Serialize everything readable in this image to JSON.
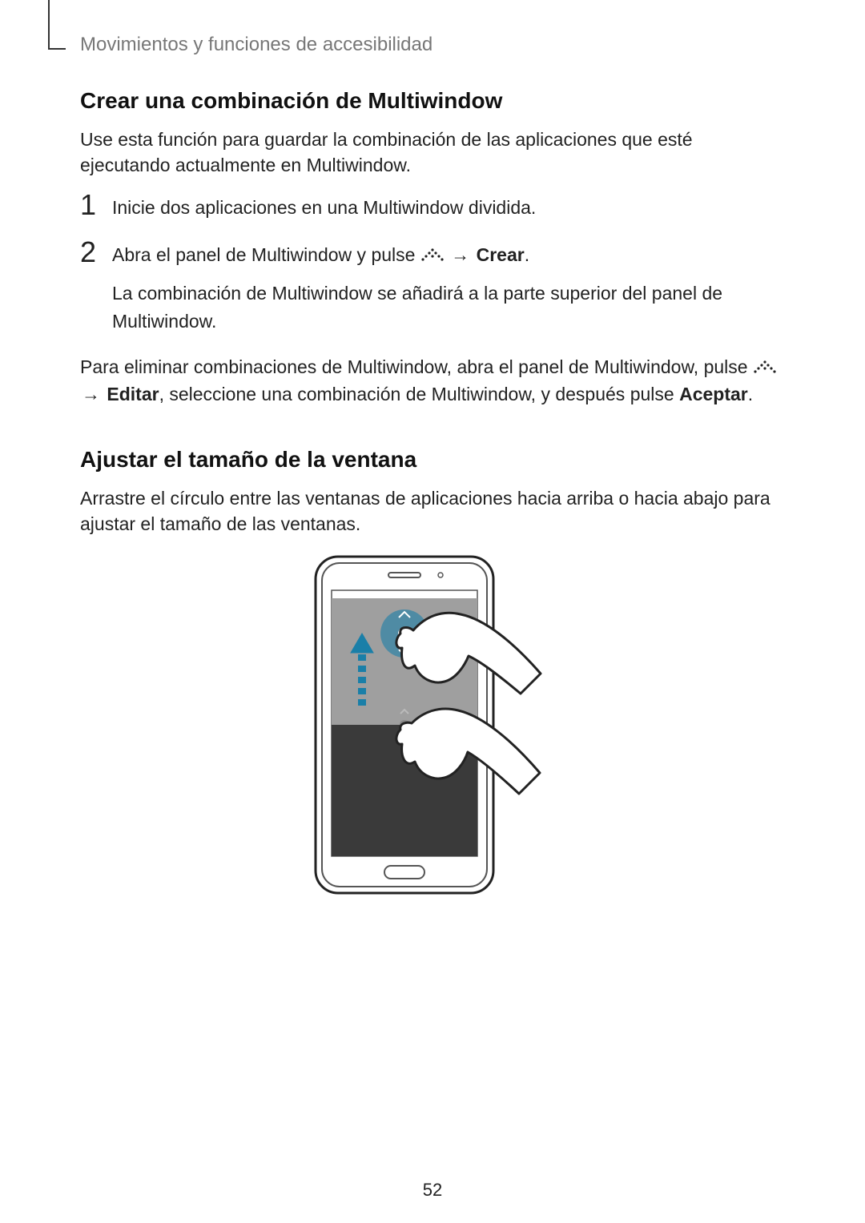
{
  "breadcrumb": "Movimientos y funciones de accesibilidad",
  "section1": {
    "title": "Crear una combinación de Multiwindow",
    "intro": "Use esta función para guardar la combinación de las aplicaciones que esté ejecutando actualmente en Multiwindow.",
    "step1_num": "1",
    "step1_text": "Inicie dos aplicaciones en una Multiwindow dividida.",
    "step2_num": "2",
    "step2_text_a": "Abra el panel de Multiwindow y pulse ",
    "step2_arrow": "→",
    "step2_crear": "Crear",
    "step2_period": ".",
    "step2_sub": "La combinación de Multiwindow se añadirá a la parte superior del panel de Multiwindow.",
    "after_a": "Para eliminar combinaciones de Multiwindow, abra el panel de Multiwindow, pulse ",
    "after_arrow": "→",
    "after_editar": "Editar",
    "after_b": ", seleccione una combinación de Multiwindow, y después pulse ",
    "after_aceptar": "Aceptar",
    "after_period": "."
  },
  "section2": {
    "title": "Ajustar el tamaño de la ventana",
    "intro": "Arrastre el círculo entre las ventanas de aplicaciones hacia arriba o hacia abajo para ajustar el tamaño de las ventanas."
  },
  "page_number": "52"
}
